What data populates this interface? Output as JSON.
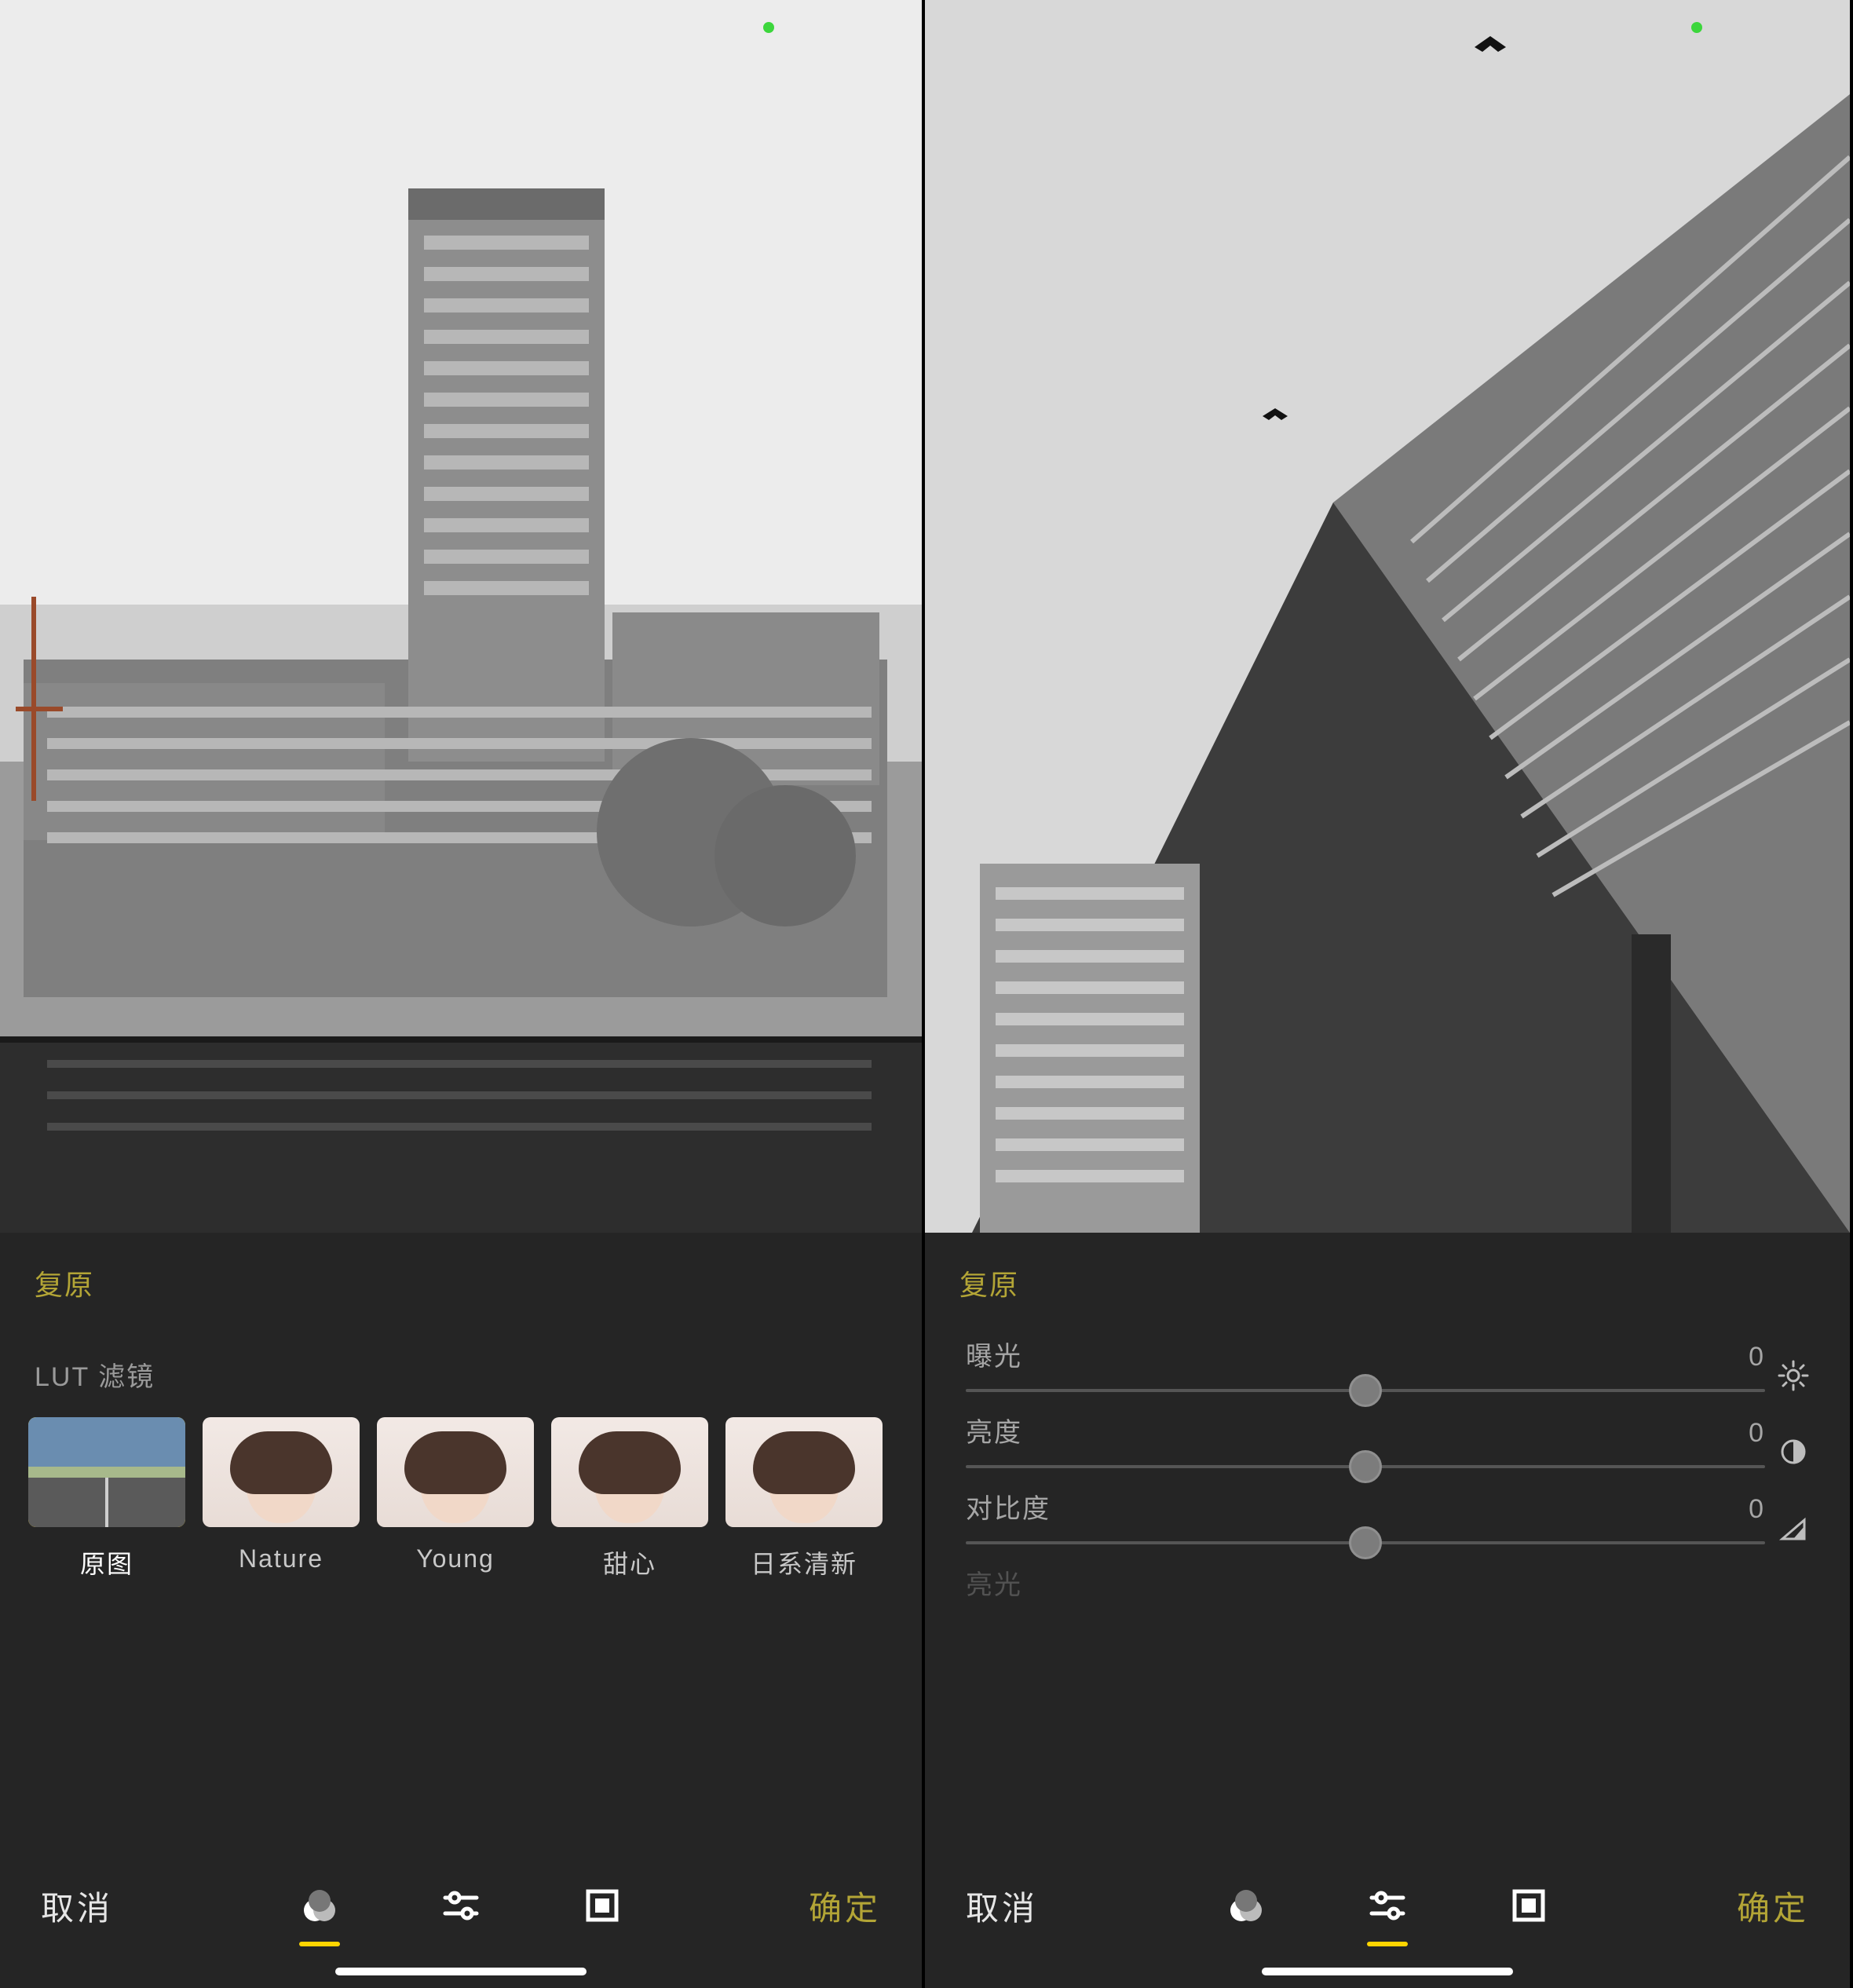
{
  "colors": {
    "accent": "#ffd500",
    "accentDim": "#b3a536",
    "indicator": "#3cd63c"
  },
  "left": {
    "reset_label": "复原",
    "section_title": "LUT 滤镜",
    "filters": [
      {
        "label": "原图",
        "selected": true,
        "kind": "road"
      },
      {
        "label": "Nature",
        "selected": false,
        "kind": "face"
      },
      {
        "label": "Young",
        "selected": false,
        "kind": "face"
      },
      {
        "label": "甜心",
        "selected": false,
        "kind": "face"
      },
      {
        "label": "日系清新",
        "selected": false,
        "kind": "face"
      }
    ],
    "bottom": {
      "cancel": "取消",
      "confirm": "确定",
      "active_tool": "filters"
    }
  },
  "right": {
    "reset_label": "复原",
    "sliders": [
      {
        "name": "曝光",
        "value": "0",
        "icon": "sun"
      },
      {
        "name": "亮度",
        "value": "0",
        "icon": "circle-half"
      },
      {
        "name": "对比度",
        "value": "0",
        "icon": "triangle"
      },
      {
        "name": "亮光",
        "value": "",
        "icon": "",
        "faded": true
      }
    ],
    "bottom": {
      "cancel": "取消",
      "confirm": "确定",
      "active_tool": "adjust"
    }
  },
  "tools": {
    "filters": "filters-icon",
    "adjust": "sliders-icon",
    "frame": "frame-icon"
  }
}
